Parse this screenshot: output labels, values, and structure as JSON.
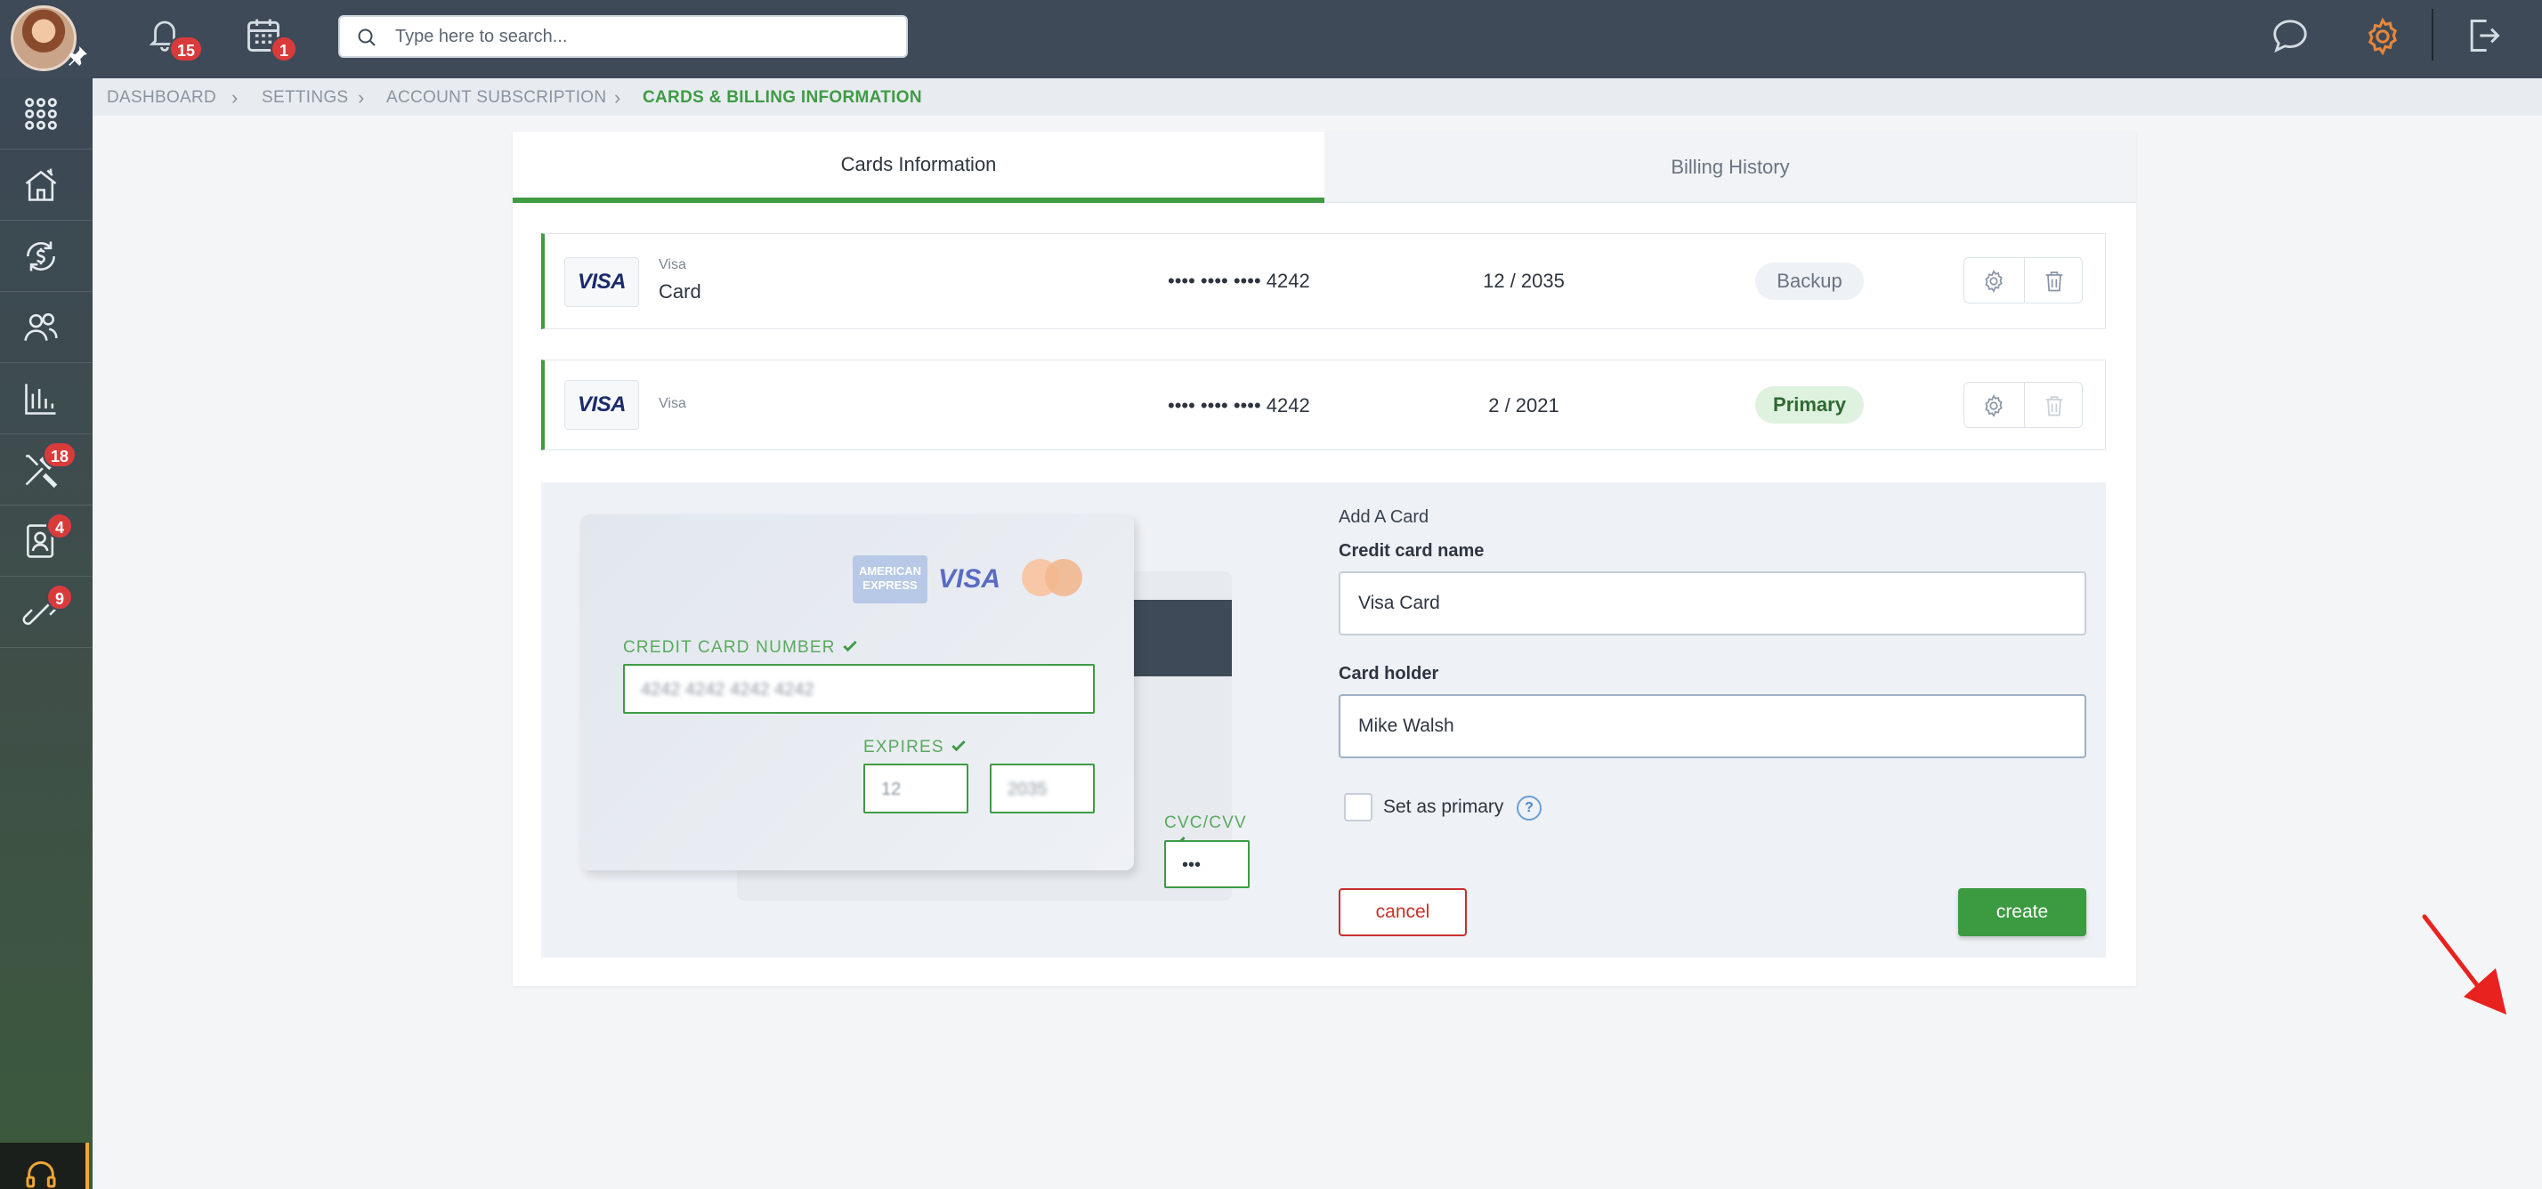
{
  "topbar": {
    "notifications_count": "15",
    "calendar_count": "1",
    "search_placeholder": "Type here to search..."
  },
  "sidebar": {
    "items": [
      {
        "icon": "apps-grid-icon",
        "badge": ""
      },
      {
        "icon": "house-icon",
        "badge": ""
      },
      {
        "icon": "dollar-cycle-icon",
        "badge": ""
      },
      {
        "icon": "users-icon",
        "badge": ""
      },
      {
        "icon": "bar-chart-icon",
        "badge": ""
      },
      {
        "icon": "tools-icon",
        "badge": "18"
      },
      {
        "icon": "contact-card-icon",
        "badge": "4"
      },
      {
        "icon": "link-icon",
        "badge": "9"
      }
    ]
  },
  "breadcrumb": {
    "items": [
      "DASHBOARD",
      "SETTINGS",
      "ACCOUNT SUBSCRIPTION",
      "CARDS & BILLING INFORMATION"
    ]
  },
  "tabs": {
    "cards": "Cards Information",
    "billing": "Billing History"
  },
  "cards": [
    {
      "logo": "VISA",
      "brand": "Visa",
      "name": "Card",
      "number": "•••• •••• •••• 4242",
      "expiry": "12 / 2035",
      "status": "Backup"
    },
    {
      "logo": "VISA",
      "brand": "Visa",
      "name": "",
      "number": "•••• •••• •••• 4242",
      "expiry": "2 / 2021",
      "status": "Primary"
    }
  ],
  "card_preview": {
    "amex_logo": "AMERICAN EXPRESS",
    "visa_logo": "VISA",
    "number_label": "CREDIT CARD NUMBER",
    "number_value": "4242 4242 4242 4242",
    "expires_label": "EXPIRES",
    "exp_month": "12",
    "exp_year": "2035",
    "cvc_label": "CVC/CVV",
    "cvc_value": "•••"
  },
  "form": {
    "title": "Add A Card",
    "name_label": "Credit card name",
    "name_value": "Visa Card",
    "holder_label": "Card holder",
    "holder_value": "Mike Walsh",
    "primary_label": "Set as primary",
    "help": "?",
    "cancel": "cancel",
    "create": "create"
  },
  "colors": {
    "accent_green": "#3f9b44",
    "topbar": "#3e4a57",
    "danger": "#c9302c",
    "settings_orange": "#e8873a"
  }
}
